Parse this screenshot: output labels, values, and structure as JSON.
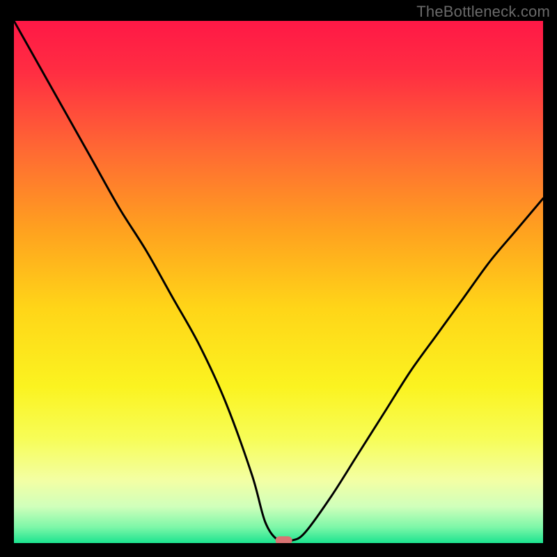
{
  "watermark": "TheBottleneck.com",
  "chart_data": {
    "type": "line",
    "title": "",
    "xlabel": "",
    "ylabel": "",
    "xlim": [
      0,
      100
    ],
    "ylim": [
      0,
      100
    ],
    "grid": false,
    "legend": false,
    "series": [
      {
        "name": "bottleneck-curve",
        "x": [
          0,
          5,
          10,
          15,
          20,
          25,
          30,
          35,
          40,
          45,
          47.5,
          50,
          52.5,
          55,
          60,
          65,
          70,
          75,
          80,
          85,
          90,
          95,
          100
        ],
        "y": [
          100,
          91,
          82,
          73,
          64,
          56,
          47,
          38,
          27,
          13,
          4,
          0.5,
          0.5,
          2,
          9,
          17,
          25,
          33,
          40,
          47,
          54,
          60,
          66
        ]
      }
    ],
    "marker": {
      "x": 51,
      "y": 0.5,
      "color": "#d97373"
    },
    "background_gradient": {
      "stops": [
        {
          "offset": 0.0,
          "color": "#ff1846"
        },
        {
          "offset": 0.1,
          "color": "#ff2e42"
        },
        {
          "offset": 0.25,
          "color": "#ff6a33"
        },
        {
          "offset": 0.4,
          "color": "#ffa11f"
        },
        {
          "offset": 0.55,
          "color": "#ffd518"
        },
        {
          "offset": 0.7,
          "color": "#fbf320"
        },
        {
          "offset": 0.8,
          "color": "#f7fd57"
        },
        {
          "offset": 0.88,
          "color": "#f3ffa4"
        },
        {
          "offset": 0.93,
          "color": "#d0ffbb"
        },
        {
          "offset": 0.97,
          "color": "#7cf7a8"
        },
        {
          "offset": 1.0,
          "color": "#1be38f"
        }
      ]
    },
    "curve_style": {
      "stroke": "#000000",
      "width": 3
    }
  }
}
